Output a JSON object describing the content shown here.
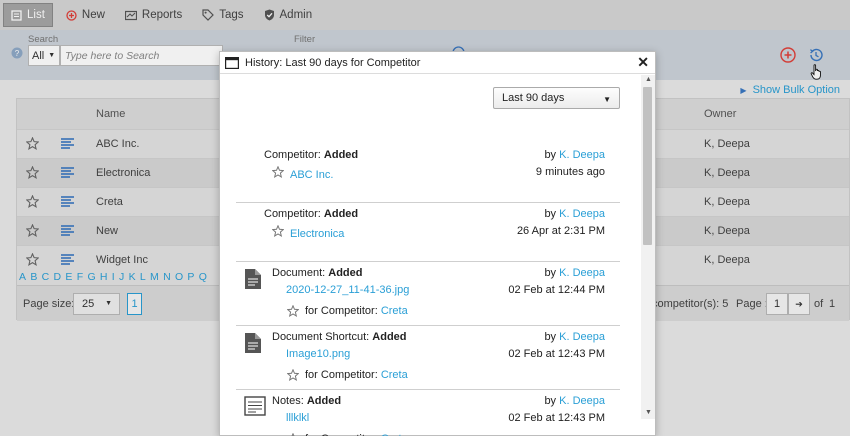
{
  "toolbar": {
    "list": "List",
    "new": "New",
    "reports": "Reports",
    "tags": "Tags",
    "admin": "Admin"
  },
  "search": {
    "label": "Search",
    "scope_value": "All",
    "placeholder": "Type here to Search",
    "filter_label": "Filter"
  },
  "grid": {
    "show_bulk": "Show Bulk Option",
    "col_name": "Name",
    "col_owner": "Owner",
    "rows": [
      {
        "name": "ABC Inc.",
        "owner": "K, Deepa"
      },
      {
        "name": "Electronica",
        "owner": "K, Deepa"
      },
      {
        "name": "Creta",
        "owner": "K, Deepa"
      },
      {
        "name": "New",
        "owner": "K, Deepa"
      },
      {
        "name": "Widget Inc",
        "owner": "K, Deepa"
      }
    ],
    "alphabet": [
      "A",
      "B",
      "C",
      "D",
      "E",
      "F",
      "G",
      "H",
      "I",
      "J",
      "K",
      "L",
      "M",
      "N",
      "O",
      "P",
      "Q"
    ],
    "page_size_label": "Page size:",
    "page_size_value": "25",
    "current_page_btn": "1",
    "count_text": "competitor(s): 5",
    "page_label": "Page :",
    "page_value": "1",
    "of_text": "of",
    "total_pages": "1"
  },
  "modal": {
    "title": "History: Last 90 days for Competitor",
    "period": "Last 90 days",
    "entries": [
      {
        "kind": "Competitor:",
        "action": "Added",
        "item": "ABC Inc.",
        "by_label": "by",
        "user": "K. Deepa",
        "when": "9 minutes ago"
      },
      {
        "kind": "Competitor:",
        "action": "Added",
        "item": "Electronica",
        "by_label": "by",
        "user": "K. Deepa",
        "when": "26 Apr at 2:31 PM"
      },
      {
        "kind": "Document:",
        "action": "Added",
        "item": "2020-12-27_11-41-36.jpg",
        "for_label": "for Competitor:",
        "for_item": "Creta",
        "by_label": "by",
        "user": "K. Deepa",
        "when": "02 Feb at 12:44 PM"
      },
      {
        "kind": "Document Shortcut:",
        "action": "Added",
        "item": "Image10.png",
        "for_label": "for Competitor:",
        "for_item": "Creta",
        "by_label": "by",
        "user": "K. Deepa",
        "when": "02 Feb at 12:43 PM"
      },
      {
        "kind": "Notes:",
        "action": "Added",
        "item": "lllklkl",
        "for_label": "for Competitor:",
        "for_item": "Creta",
        "by_label": "by",
        "user": "K. Deepa",
        "when": "02 Feb at 12:43 PM"
      }
    ]
  },
  "colors": {
    "link": "#2a9fd6",
    "add_red": "#e0403a",
    "history_blue": "#3a78c2"
  }
}
